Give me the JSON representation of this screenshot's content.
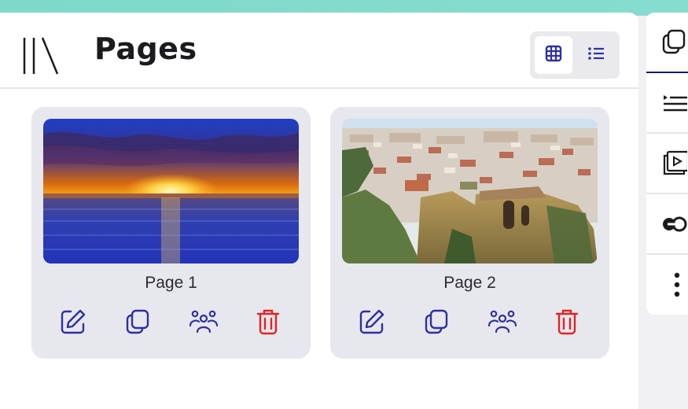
{
  "header": {
    "title": "Pages",
    "library_icon": "library-icon",
    "view_toggle": {
      "options": [
        {
          "name": "grid-view",
          "icon": "grid-icon",
          "selected": true
        },
        {
          "name": "list-view",
          "icon": "list-icon",
          "selected": false
        }
      ]
    }
  },
  "pages": [
    {
      "label": "Page 1",
      "thumbnail": "sunset-over-sea"
    },
    {
      "label": "Page 2",
      "thumbnail": "aerial-town-on-cliff"
    }
  ],
  "card_actions": [
    {
      "name": "edit",
      "icon": "edit-icon"
    },
    {
      "name": "duplicate",
      "icon": "copy-icon"
    },
    {
      "name": "collaborators",
      "icon": "people-icon"
    },
    {
      "name": "delete",
      "icon": "trash-icon"
    }
  ],
  "side_toolbar": [
    {
      "name": "pages",
      "icon": "copy-icon",
      "active": true
    },
    {
      "name": "outline",
      "icon": "list-icon"
    },
    {
      "name": "slideshow",
      "icon": "slideshow-icon"
    },
    {
      "name": "link",
      "icon": "link-icon"
    },
    {
      "name": "more",
      "icon": "more-vertical-icon"
    }
  ],
  "colors": {
    "accent": "#2f2fa2",
    "danger": "#e02424",
    "card_bg": "#e7e7ee",
    "top_strip": "#7ed9cb"
  }
}
